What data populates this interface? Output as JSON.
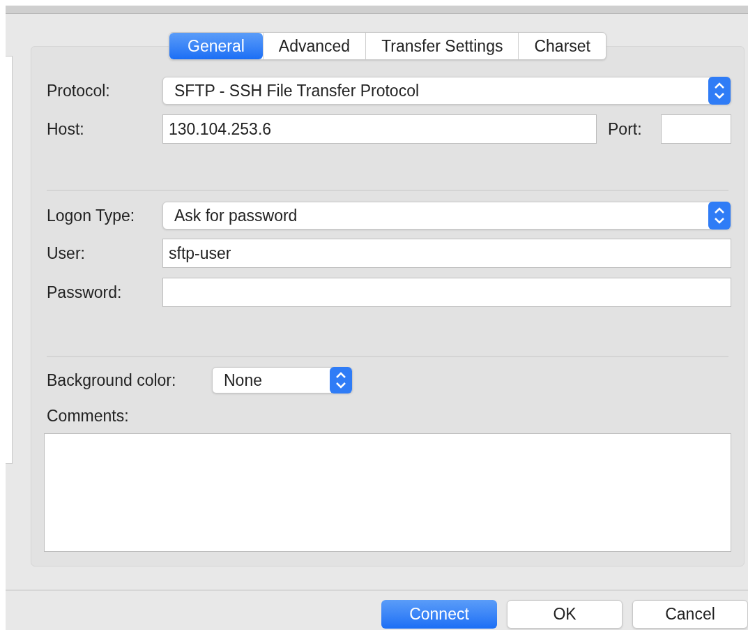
{
  "tabs": [
    {
      "label": "General",
      "selected": true
    },
    {
      "label": "Advanced",
      "selected": false
    },
    {
      "label": "Transfer Settings",
      "selected": false
    },
    {
      "label": "Charset",
      "selected": false
    }
  ],
  "protocol": {
    "label": "Protocol:",
    "value": "SFTP - SSH File Transfer Protocol"
  },
  "host": {
    "label": "Host:",
    "value": "130.104.253.6"
  },
  "port": {
    "label": "Port:"
  },
  "logon_type": {
    "label": "Logon Type:",
    "value": "Ask for password"
  },
  "user": {
    "label": "User:",
    "value": "sftp-user"
  },
  "password": {
    "label": "Password:"
  },
  "background_color": {
    "label": "Background color:",
    "value": "None"
  },
  "comments": {
    "label": "Comments:"
  },
  "buttons": [
    {
      "label": "Connect",
      "default": true
    },
    {
      "label": "OK",
      "default": false
    },
    {
      "label": "Cancel",
      "default": false
    }
  ]
}
